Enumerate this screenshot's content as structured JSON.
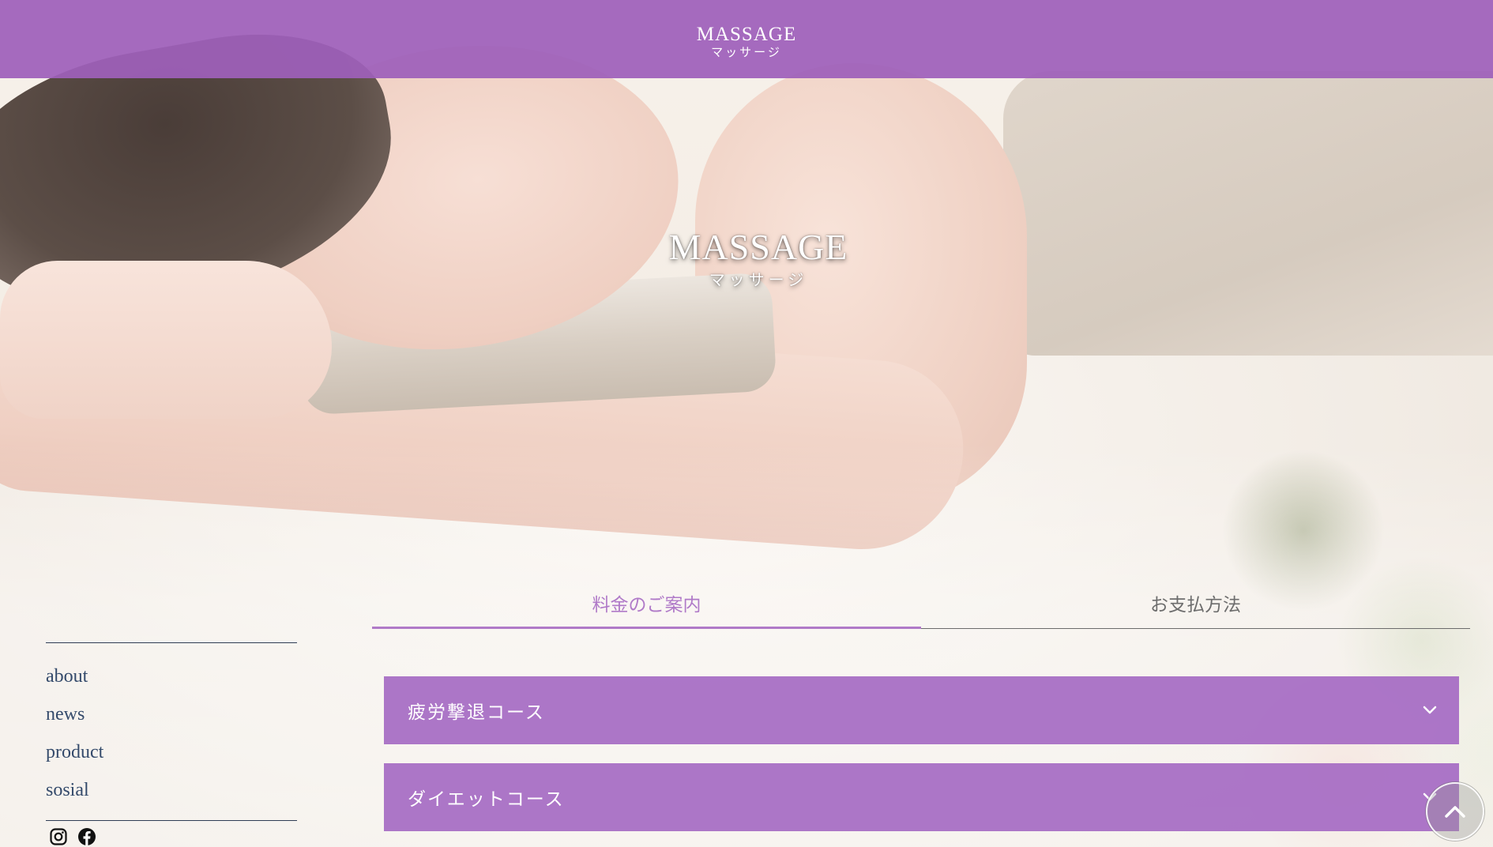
{
  "header": {
    "logo_en": "MASSAGE",
    "logo_ja": "マッサージ"
  },
  "hero": {
    "title_en": "MASSAGE",
    "title_ja": "マッサージ"
  },
  "tabs": [
    {
      "label": "料金のご案内",
      "active": true
    },
    {
      "label": "お支払方法",
      "active": false
    }
  ],
  "accordion": [
    {
      "label": "疲労撃退コース"
    },
    {
      "label": "ダイエットコース"
    }
  ],
  "sidebar": {
    "items": [
      {
        "label": "about"
      },
      {
        "label": "news"
      },
      {
        "label": "product"
      },
      {
        "label": "sosial"
      }
    ],
    "social_icons": [
      "instagram-icon",
      "facebook-icon"
    ]
  },
  "colors": {
    "header_bg": "#9e60ba",
    "accent": "#b07ac8",
    "accordion_bg": "#a66cc4",
    "nav_text": "#344a6b"
  },
  "icons": {
    "accordion_toggle": "chevron-down-icon",
    "back_to_top": "chevron-up-icon"
  }
}
